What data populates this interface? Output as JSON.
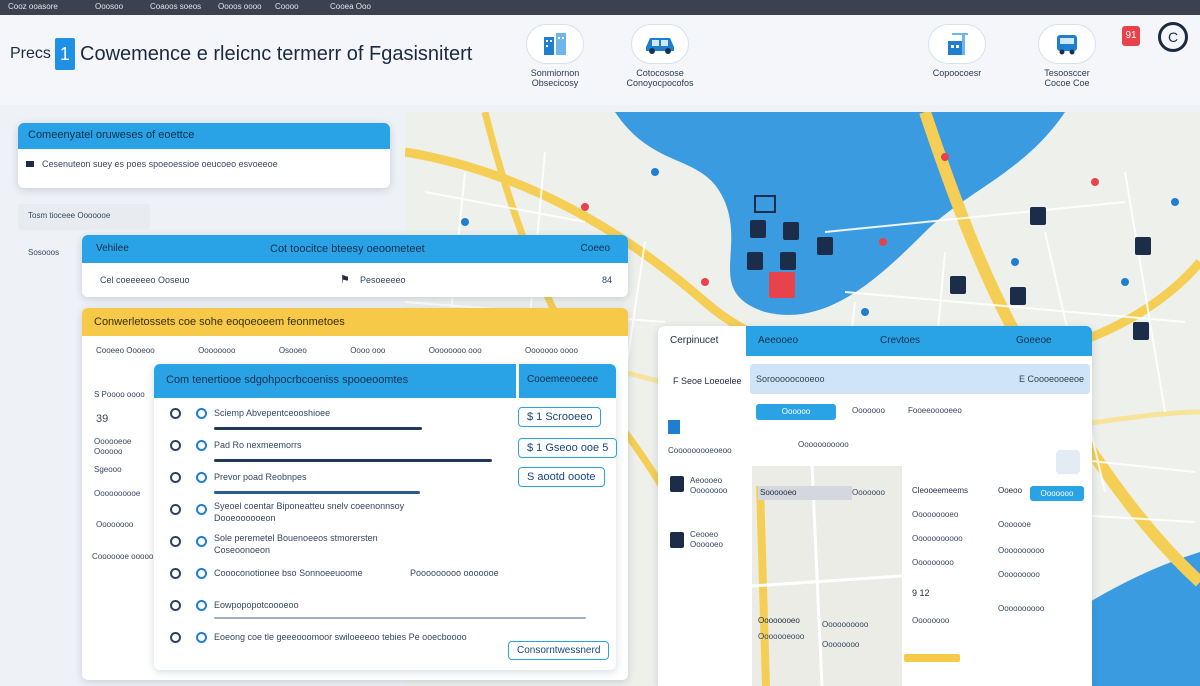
{
  "topbar": {
    "items": [
      "Cooz ooasore",
      "Ooosoo",
      "Coaoos soeos",
      "Oooos oooo",
      "Coooo",
      "Cooea Ooo"
    ]
  },
  "header": {
    "logo_text": "Precs",
    "logo_number": "1",
    "title": "Cowemence e rleicnc termerr of Fgasisnitert",
    "nav_icons": [
      {
        "icon": "building-icon",
        "label_1": "Sonmiornon",
        "label_2": "Obsecicosy"
      },
      {
        "icon": "car-icon",
        "label_1": "Cotocosose",
        "label_2": "Conoyocpocofos"
      },
      {
        "icon": "building-crane-icon",
        "label_1": "Copoocoesr",
        "label_2": ""
      },
      {
        "icon": "bus-icon",
        "label_1": "Tesoosccer",
        "label_2": "Cocoe Coe"
      }
    ],
    "right_badge": "91",
    "right_logo": "C"
  },
  "panel_a": {
    "title": "Comeenyatel oruweses of eoettce",
    "row_text": "Cesenuteon suey es poes spoeoessioe oeucoeo esvoeeoe"
  },
  "filter_chip": "Tosm tioceee Ooooooe",
  "side_label": "Sosooos",
  "panel_b": {
    "header_left": "Vehilee",
    "header_center": "Cot toocitce bteesy oeoometeet",
    "header_right": "Coeeo",
    "row_left": "Cel coeeeeeo   Ooseuo",
    "row_middle": "Pesoeeeeo",
    "row_right": "84"
  },
  "panel_c": {
    "title": "Conwerletossets coe sohe eoqoeoeem feonmetoes",
    "columns": [
      "Cooeeo Oooeoo",
      "Oooooooo",
      "Osooeo",
      "Oooo ooo",
      "Oooooooo ooo",
      "Ooooooo oooo"
    ]
  },
  "left_labels": [
    "S Poooo oooo",
    "39",
    "Oooooeoe\nOooooo",
    "Sgeooo",
    "Oooooooooe",
    "Oooooooo",
    "Cooooooe ooooo"
  ],
  "panel_d": {
    "title": "Com tenertiooe sdgohpocrbcoeniss spooeoomtes",
    "tab": "Cooemeeoeeee",
    "rows": [
      {
        "text": "Sciemp Abvepentceooshioee",
        "sub": ""
      },
      {
        "text": "Pad Ro nexmeemorrs",
        "sub": ""
      },
      {
        "text": "Prevor poad Reobnpes",
        "sub": ""
      },
      {
        "text": "Syeoel coentar Biponeatteu snelv coeenonnsoy",
        "sub": "Dooeoooooeon"
      },
      {
        "text": "Sole peremetel Bouenoeeos stmorersten",
        "sub": "Coseoonoeon"
      },
      {
        "text": "Coooconotionee bso Sonnoeeuoome",
        "sub": "Pooooooooo ooooooe"
      },
      {
        "text": "Eowpopopotcoooeoo",
        "sub": ""
      },
      {
        "text": "Eoeong coe tle geeeooomoor swiloeeeoo tebies Pe ooecboooo",
        "sub": ""
      }
    ],
    "prices": [
      "$ 1 Scrooeeo",
      "$ 1 Gseoo ooe 5",
      "S aootd ooote"
    ],
    "footer_button": "Consorntwessnerd"
  },
  "panel_e": {
    "tabs": [
      "Cerpinucet",
      "Aeeooeo",
      "Crevtoes",
      "Goeeoe"
    ],
    "search_placeholder": "Sorooooocooeoo",
    "search_value": "E Coooeooeeoe",
    "left_label": "F Seoe Loeoelee",
    "left_items": [
      {
        "icon": "square-icon",
        "text": "Ooooooooooo"
      },
      {
        "icon": "list-icon",
        "text": "Cooooooooeoeoo"
      },
      {
        "icon": "car-icon",
        "text": "Aeoooeo\nOooooooo"
      },
      {
        "icon": "id-icon",
        "text": "Ceooeo\nOooooeo"
      }
    ],
    "pill": "Oooooo",
    "col_headers": [
      "Ooooooo",
      "Fooeeooooeeo"
    ],
    "label_mid": "Ooooooooooo",
    "mid_items": [
      "Soooooeo",
      "Ooooooo"
    ],
    "col3": [
      "Cleooeemeems",
      "Ooooooooeo",
      "Ooooooooooo",
      "Ooooooooo",
      "9 12",
      "Oooooooo"
    ],
    "col4": [
      "Ooeoo",
      "Ooooooe",
      "Oooooooooo",
      "Ooooooooo",
      "Oooooooooo"
    ],
    "small_button": "Ooooooo",
    "bottom_labels": [
      "Oooooooeo",
      "Oooooooooo",
      "Ooooooeooo",
      "Oooooooo"
    ]
  },
  "colors": {
    "accent_blue": "#2aa3e6",
    "accent_yellow": "#f7c948",
    "topbar": "#3a4250",
    "water": "#3a9be0"
  }
}
